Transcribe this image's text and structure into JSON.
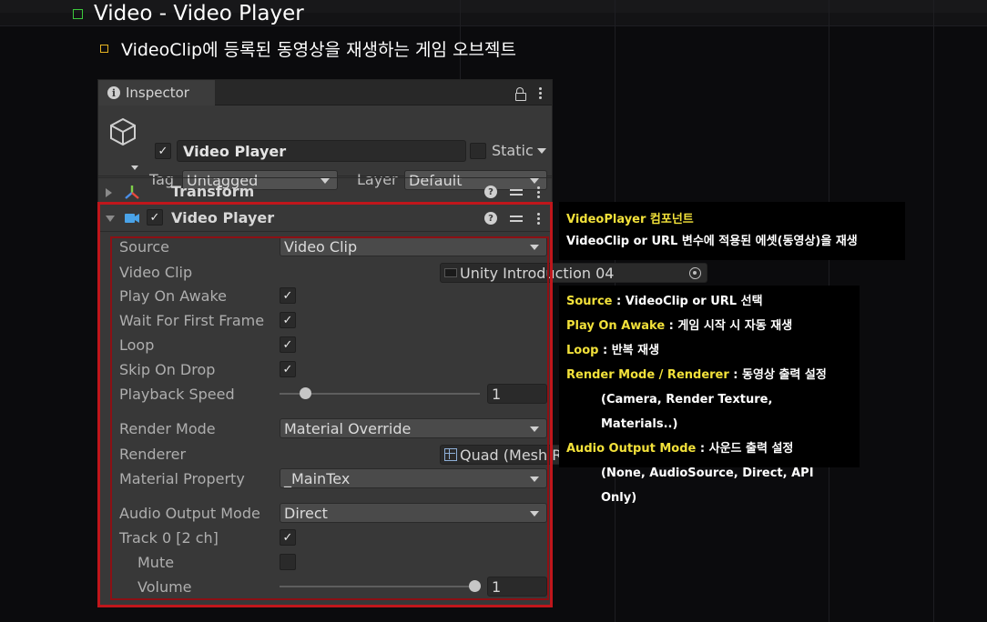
{
  "slide": {
    "title": "Video - Video Player",
    "subtitle": "VideoClip에 등록된 동영상을 재생하는 게임 오브젝트"
  },
  "inspector": {
    "tab_label": "Inspector",
    "gameobject": {
      "name": "Video Player",
      "static_label": "Static",
      "tag_label": "Tag",
      "tag_value": "Untagged",
      "layer_label": "Layer",
      "layer_value": "Default"
    },
    "transform": {
      "title": "Transform"
    },
    "video_player": {
      "title": "Video Player",
      "source_label": "Source",
      "source_value": "Video Clip",
      "video_clip_label": "Video Clip",
      "video_clip_value": "Unity Introduction 04",
      "play_on_awake_label": "Play On Awake",
      "wait_first_frame_label": "Wait For First Frame",
      "loop_label": "Loop",
      "skip_on_drop_label": "Skip On Drop",
      "playback_speed_label": "Playback Speed",
      "playback_speed_value": "1",
      "render_mode_label": "Render Mode",
      "render_mode_value": "Material Override",
      "renderer_label": "Renderer",
      "renderer_value": "Quad (Mesh Renderer)",
      "material_property_label": "Material Property",
      "material_property_value": "_MainTex",
      "audio_output_label": "Audio Output Mode",
      "audio_output_value": "Direct",
      "track_label": "Track 0 [2 ch]",
      "mute_label": "Mute",
      "volume_label": "Volume",
      "volume_value": "1"
    }
  },
  "callout_top": {
    "line1": "VideoPlayer 컴포넌트",
    "line2": "VideoClip or URL 변수에 적용된 에셋(동영상)을 재생"
  },
  "callout_bottom": {
    "source_key": "Source",
    "source_desc": " : VideoClip or URL 선택",
    "awake_key": "Play On Awake",
    "awake_desc": " : 게임 시작 시 자동 재생",
    "loop_key": "Loop",
    "loop_desc": " : 반복 재생",
    "render_key": "Render Mode / Renderer",
    "render_desc": " : 동영상 출력 설정",
    "render_detail": "(Camera, Render Texture, Materials..)",
    "audio_key": "Audio Output Mode",
    "audio_desc": " : 사운드 출력 설정",
    "audio_detail": "(None, AudioSource, Direct, API Only)"
  },
  "colors": {
    "highlight": "#c0161b",
    "callout_key": "#f2e13a",
    "title_bullet": "#3cc83c",
    "subtitle_bullet": "#e6b422"
  }
}
